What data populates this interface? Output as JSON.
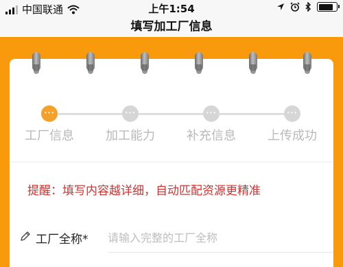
{
  "status_bar": {
    "carrier": "中国联通",
    "time": "上午1:54",
    "wifi_icon": "wifi-icon",
    "location_icon": "location-arrow-icon",
    "alarm_icon": "alarm-clock-icon",
    "bluetooth_icon": "bluetooth-icon",
    "battery_level": 0.8
  },
  "nav": {
    "title": "填写加工厂信息"
  },
  "steps": [
    {
      "label": "工厂信息",
      "dots": "···",
      "active": true
    },
    {
      "label": "加工能力",
      "dots": "···",
      "active": false
    },
    {
      "label": "补充信息",
      "dots": "···",
      "active": false
    },
    {
      "label": "上传成功",
      "dots": "···",
      "active": false
    }
  ],
  "tip": "提醒：填写内容越详细，自动匹配资源更精准",
  "form": {
    "factory_name": {
      "label": "工厂全称*",
      "placeholder": "请输入完整的工厂全称",
      "value": ""
    }
  },
  "colors": {
    "accent_orange": "#f99a0d",
    "step_active": "#f4a12c",
    "tip_red": "#d4312f"
  }
}
